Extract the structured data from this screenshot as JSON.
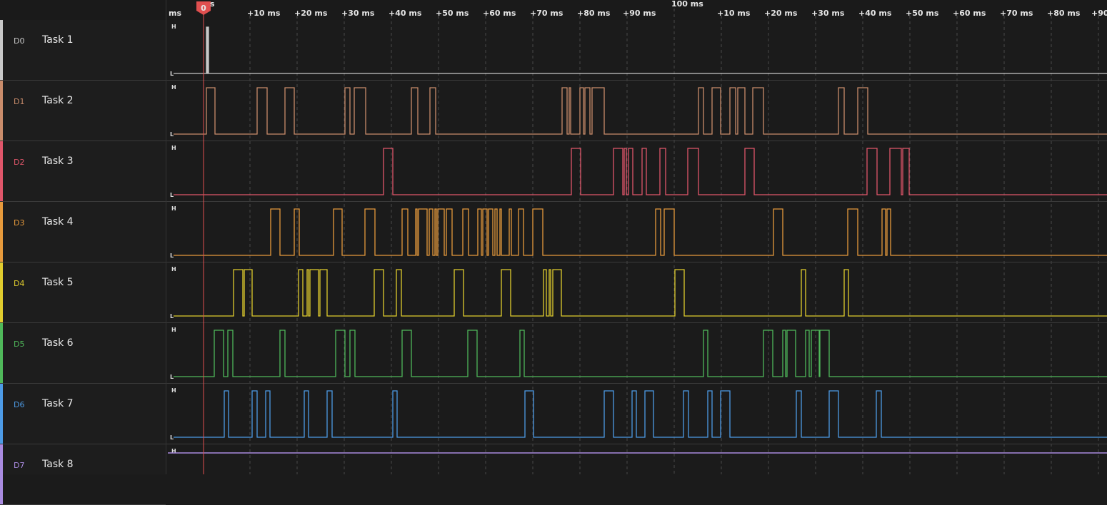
{
  "timeline": {
    "unit_label": "ms",
    "marker_label": "0",
    "marker_suffix": "s",
    "major_label": "100 ms",
    "ticks": [
      "+10 ms",
      "+20 ms",
      "+30 ms",
      "+40 ms",
      "+50 ms",
      "+60 ms",
      "+70 ms",
      "+80 ms",
      "+90 ms",
      "+10 ms",
      "+20 ms",
      "+30 ms",
      "+40 ms",
      "+50 ms",
      "+60 ms",
      "+70 ms",
      "+80 ms",
      "+90"
    ]
  },
  "level_labels": {
    "high": "H",
    "low": "L"
  },
  "colors": {
    "background": "#1b1b1b",
    "grid": "#4a4a4a",
    "marker": "#e04f4f",
    "channels": [
      "#c8c8c8",
      "#c98c6b",
      "#e0566a",
      "#e69a3c",
      "#e0cc2e",
      "#4fb85a",
      "#4d9be6",
      "#a98be0"
    ]
  },
  "channels": [
    {
      "id": "D0",
      "name": "Task 1",
      "edges": [
        [
          289,
          290
        ],
        [
          291,
          292
        ]
      ]
    },
    {
      "id": "D1",
      "name": "Task 2",
      "edges": [
        [
          289,
          301
        ],
        [
          360,
          374
        ],
        [
          399,
          412
        ],
        [
          483,
          490
        ],
        [
          496,
          512
        ],
        [
          576,
          585
        ],
        [
          602,
          610
        ],
        [
          787,
          794
        ],
        [
          797,
          799
        ],
        [
          812,
          817
        ],
        [
          819,
          826
        ],
        [
          829,
          846
        ],
        [
          978,
          985
        ],
        [
          997,
          1009
        ],
        [
          1022,
          1030
        ],
        [
          1033,
          1043
        ],
        [
          1054,
          1069
        ],
        [
          1174,
          1182
        ],
        [
          1201,
          1215
        ]
      ]
    },
    {
      "id": "D2",
      "name": "Task 3",
      "edges": [
        [
          537,
          550
        ],
        [
          800,
          813
        ],
        [
          859,
          872
        ],
        [
          874,
          877
        ],
        [
          880,
          886
        ],
        [
          899,
          905
        ],
        [
          924,
          932
        ],
        [
          963,
          978
        ],
        [
          1043,
          1056
        ],
        [
          1214,
          1228
        ],
        [
          1246,
          1262
        ],
        [
          1264,
          1273
        ]
      ]
    },
    {
      "id": "D3",
      "name": "Task 4",
      "edges": [
        [
          379,
          392
        ],
        [
          412,
          419
        ],
        [
          467,
          479
        ],
        [
          511,
          525
        ],
        [
          563,
          571
        ],
        [
          582,
          584
        ],
        [
          586,
          598
        ],
        [
          601,
          606
        ],
        [
          609,
          611
        ],
        [
          613,
          622
        ],
        [
          625,
          633
        ],
        [
          648,
          656
        ],
        [
          669,
          674
        ],
        [
          676,
          682
        ],
        [
          684,
          690
        ],
        [
          693,
          696
        ],
        [
          700,
          702
        ],
        [
          713,
          716
        ],
        [
          726,
          733
        ],
        [
          746,
          760
        ],
        [
          918,
          925
        ],
        [
          930,
          944
        ],
        [
          1083,
          1096
        ],
        [
          1187,
          1201
        ],
        [
          1235,
          1240
        ],
        [
          1242,
          1247
        ]
      ]
    },
    {
      "id": "D4",
      "name": "Task 5",
      "edges": [
        [
          327,
          340
        ],
        [
          342,
          353
        ],
        [
          418,
          424
        ],
        [
          430,
          432
        ],
        [
          434,
          446
        ],
        [
          448,
          458
        ],
        [
          524,
          537
        ],
        [
          555,
          562
        ],
        [
          636,
          649
        ],
        [
          702,
          715
        ],
        [
          761,
          765
        ],
        [
          769,
          771
        ],
        [
          774,
          786
        ],
        [
          945,
          958
        ],
        [
          1122,
          1128
        ],
        [
          1182,
          1188
        ]
      ]
    },
    {
      "id": "D5",
      "name": "Task 6",
      "edges": [
        [
          300,
          313
        ],
        [
          319,
          326
        ],
        [
          392,
          399
        ],
        [
          470,
          483
        ],
        [
          490,
          497
        ],
        [
          563,
          576
        ],
        [
          655,
          668
        ],
        [
          728,
          734
        ],
        [
          985,
          991
        ],
        [
          1069,
          1082
        ],
        [
          1096,
          1100
        ],
        [
          1102,
          1114
        ],
        [
          1128,
          1133
        ],
        [
          1136,
          1147
        ],
        [
          1148,
          1161
        ]
      ]
    },
    {
      "id": "D6",
      "name": "Task 7",
      "edges": [
        [
          314,
          320
        ],
        [
          353,
          360
        ],
        [
          372,
          378
        ],
        [
          426,
          432
        ],
        [
          458,
          465
        ],
        [
          550,
          556
        ],
        [
          735,
          747
        ],
        [
          846,
          859
        ],
        [
          885,
          891
        ],
        [
          903,
          915
        ],
        [
          957,
          964
        ],
        [
          991,
          997
        ],
        [
          1009,
          1022
        ],
        [
          1115,
          1122
        ],
        [
          1161,
          1174
        ],
        [
          1227,
          1234
        ]
      ]
    },
    {
      "id": "D7",
      "name": "Task 8",
      "edges": []
    }
  ]
}
